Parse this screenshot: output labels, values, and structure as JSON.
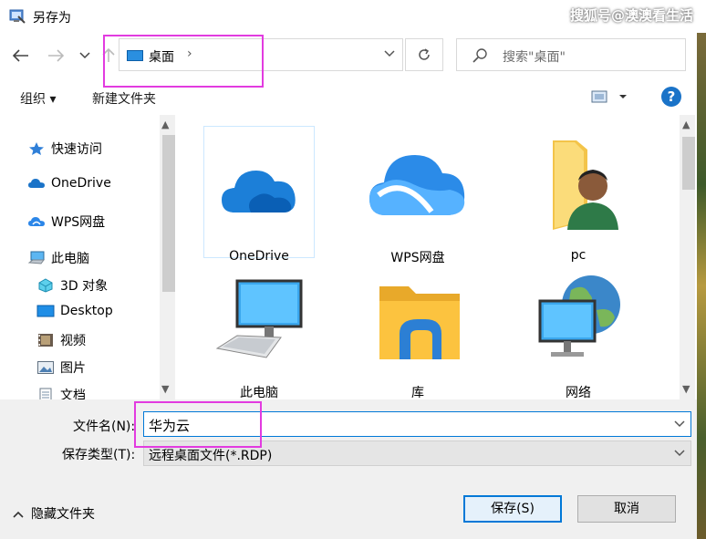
{
  "window": {
    "title": "另存为",
    "watermark": "搜狐号@澳澳看生活"
  },
  "nav": {
    "back_icon": "arrow-left-icon",
    "forward_icon": "arrow-right-icon",
    "recent_icon": "chevron-down-icon",
    "up_icon": "arrow-up-icon",
    "address": "桌面",
    "search_placeholder": "搜索\"桌面\""
  },
  "toolbar": {
    "organize": "组织 ▾",
    "new_folder": "新建文件夹",
    "help": "?"
  },
  "sidebar": {
    "items": [
      {
        "label": "快速访问",
        "icon": "star-icon"
      },
      {
        "label": "OneDrive",
        "icon": "onedrive-cloud-icon"
      },
      {
        "label": "WPS网盘",
        "icon": "wps-cloud-icon"
      },
      {
        "label": "此电脑",
        "icon": "computer-icon"
      },
      {
        "label": "3D 对象",
        "icon": "3d-objects-icon"
      },
      {
        "label": "Desktop",
        "icon": "desktop-icon"
      },
      {
        "label": "视频",
        "icon": "video-icon"
      },
      {
        "label": "图片",
        "icon": "pictures-icon"
      },
      {
        "label": "文档",
        "icon": "documents-icon"
      }
    ]
  },
  "main": {
    "items": [
      {
        "label": "OneDrive",
        "icon": "onedrive-cloud-icon"
      },
      {
        "label": "WPS网盘",
        "icon": "wps-cloud-icon"
      },
      {
        "label": "pc",
        "icon": "user-folder-icon"
      },
      {
        "label": "此电脑",
        "icon": "computer-icon"
      },
      {
        "label": "库",
        "icon": "library-folder-icon"
      },
      {
        "label": "网络",
        "icon": "network-icon"
      }
    ]
  },
  "form": {
    "filename_label": "文件名(N):",
    "filename_value": "华为云",
    "filetype_label": "保存类型(T):",
    "filetype_value": "远程桌面文件(*.RDP)"
  },
  "footer": {
    "hide_folders": "隐藏文件夹",
    "save": "保存(S)",
    "cancel": "取消"
  },
  "colors": {
    "accent": "#0078d7",
    "highlight": "#e23be0"
  }
}
